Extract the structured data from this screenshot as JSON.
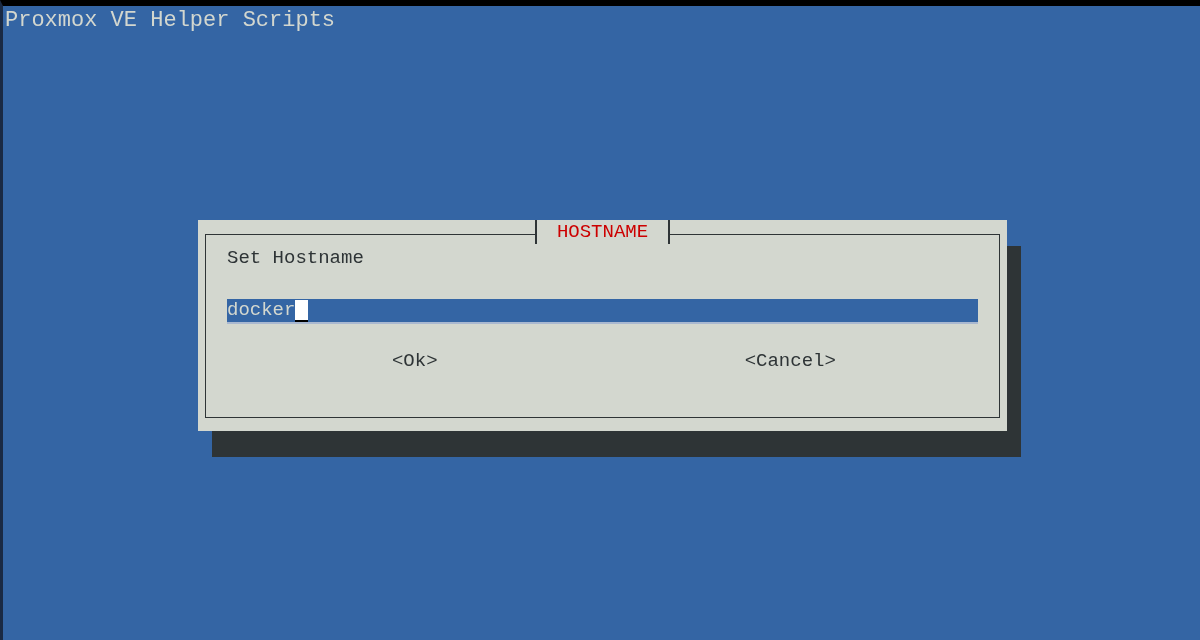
{
  "screen_title": "Proxmox VE Helper Scripts",
  "dialog": {
    "title": "HOSTNAME",
    "prompt": "Set Hostname",
    "input": {
      "value": "docker"
    },
    "buttons": [
      {
        "label": "<Ok>"
      },
      {
        "label": "<Cancel>"
      }
    ]
  }
}
